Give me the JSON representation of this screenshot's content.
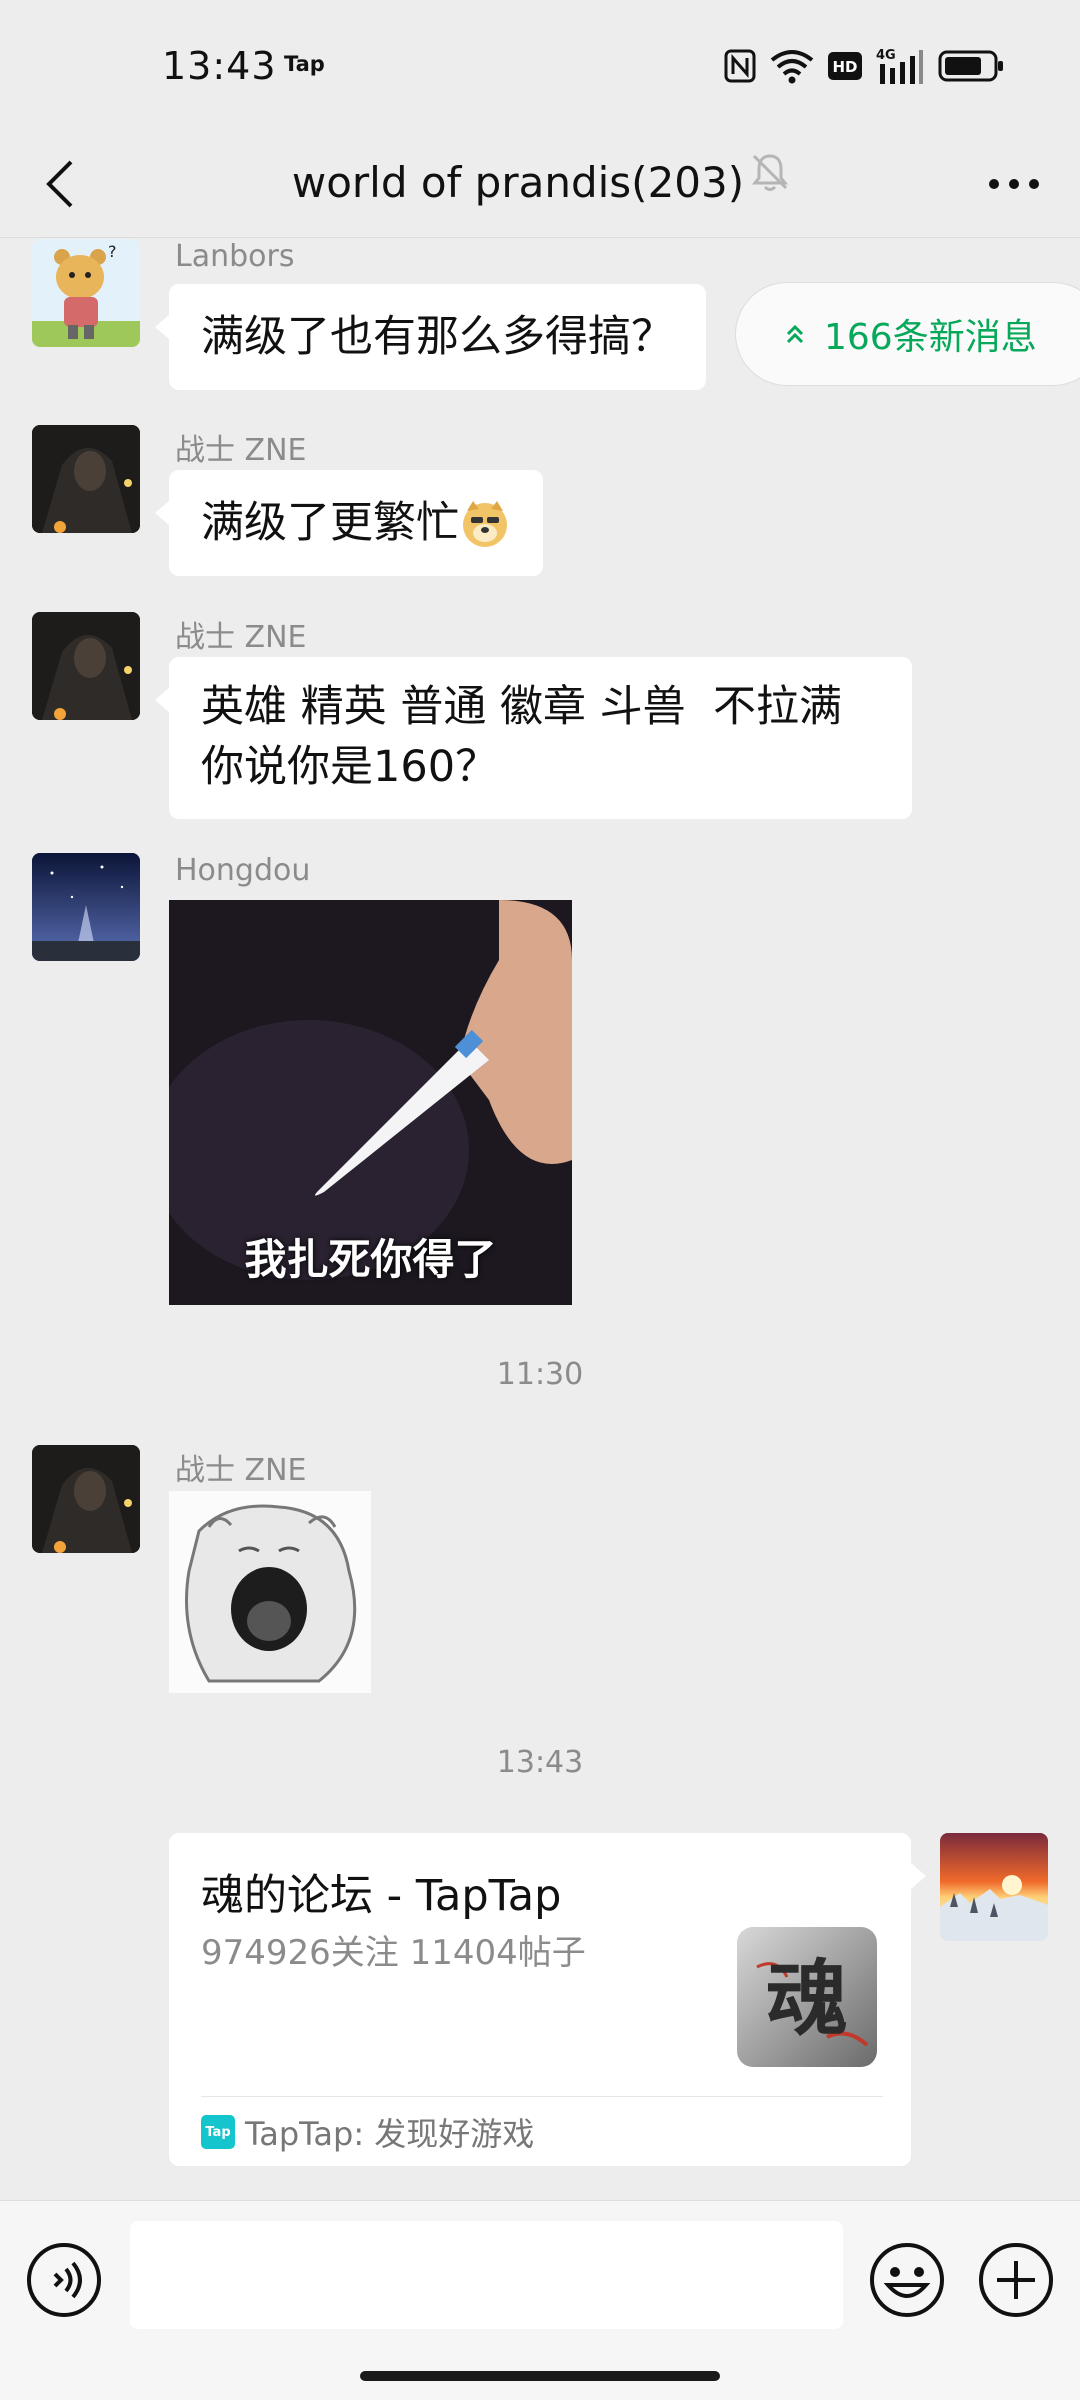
{
  "status_bar": {
    "time": "13:43",
    "app_badge": "Tap",
    "icons": [
      "nfc-icon",
      "wifi-icon",
      "hd-icon",
      "signal-4g-icon",
      "battery-icon"
    ],
    "hd_label": "HD",
    "network_label": "4G"
  },
  "header": {
    "title": "world of prandis(203)",
    "icons": [
      "back-arrow-icon",
      "mute-bell-icon",
      "more-dots-icon"
    ]
  },
  "new_messages_pill": {
    "label": "166条新消息",
    "icon": "double-chevron-up-icon",
    "color": "#07a85a"
  },
  "messages": [
    {
      "sender": "Lanbors",
      "text": "满级了也有那么多得搞？",
      "avatar": "cartoon-bear-avatar"
    },
    {
      "sender": "战士 ZNE",
      "text": "满级了更繁忙",
      "emoji": "doge-emoji",
      "avatar": "dark-warrior-avatar"
    },
    {
      "sender": "战士 ZNE",
      "lines": [
        "英雄 精英 普通 徽章 斗兽  不拉满",
        "你说你是160？"
      ],
      "avatar": "dark-warrior-avatar"
    },
    {
      "sender": "Hongdou",
      "meme_caption": "我扎死你得了",
      "avatar": "starry-sky-avatar"
    },
    {
      "sender": "战士 ZNE",
      "sticker": "screaming-blob-sticker",
      "avatar": "dark-warrior-avatar"
    }
  ],
  "timestamps": [
    "11:30",
    "13:43"
  ],
  "link_card": {
    "title": "魂的论坛 - TapTap",
    "description": "974926关注 11404帖子",
    "thumb_char": "魂",
    "source_badge": "Tap",
    "source": "TapTap: 发现好游戏"
  },
  "input_bar": {
    "value": "",
    "icons": [
      "voice-icon",
      "emoji-icon",
      "plus-icon"
    ]
  },
  "colors": {
    "background": "#ededed",
    "bubble": "#ffffff",
    "accent_green": "#07a85a",
    "taptap_cyan": "#15c5ce"
  }
}
